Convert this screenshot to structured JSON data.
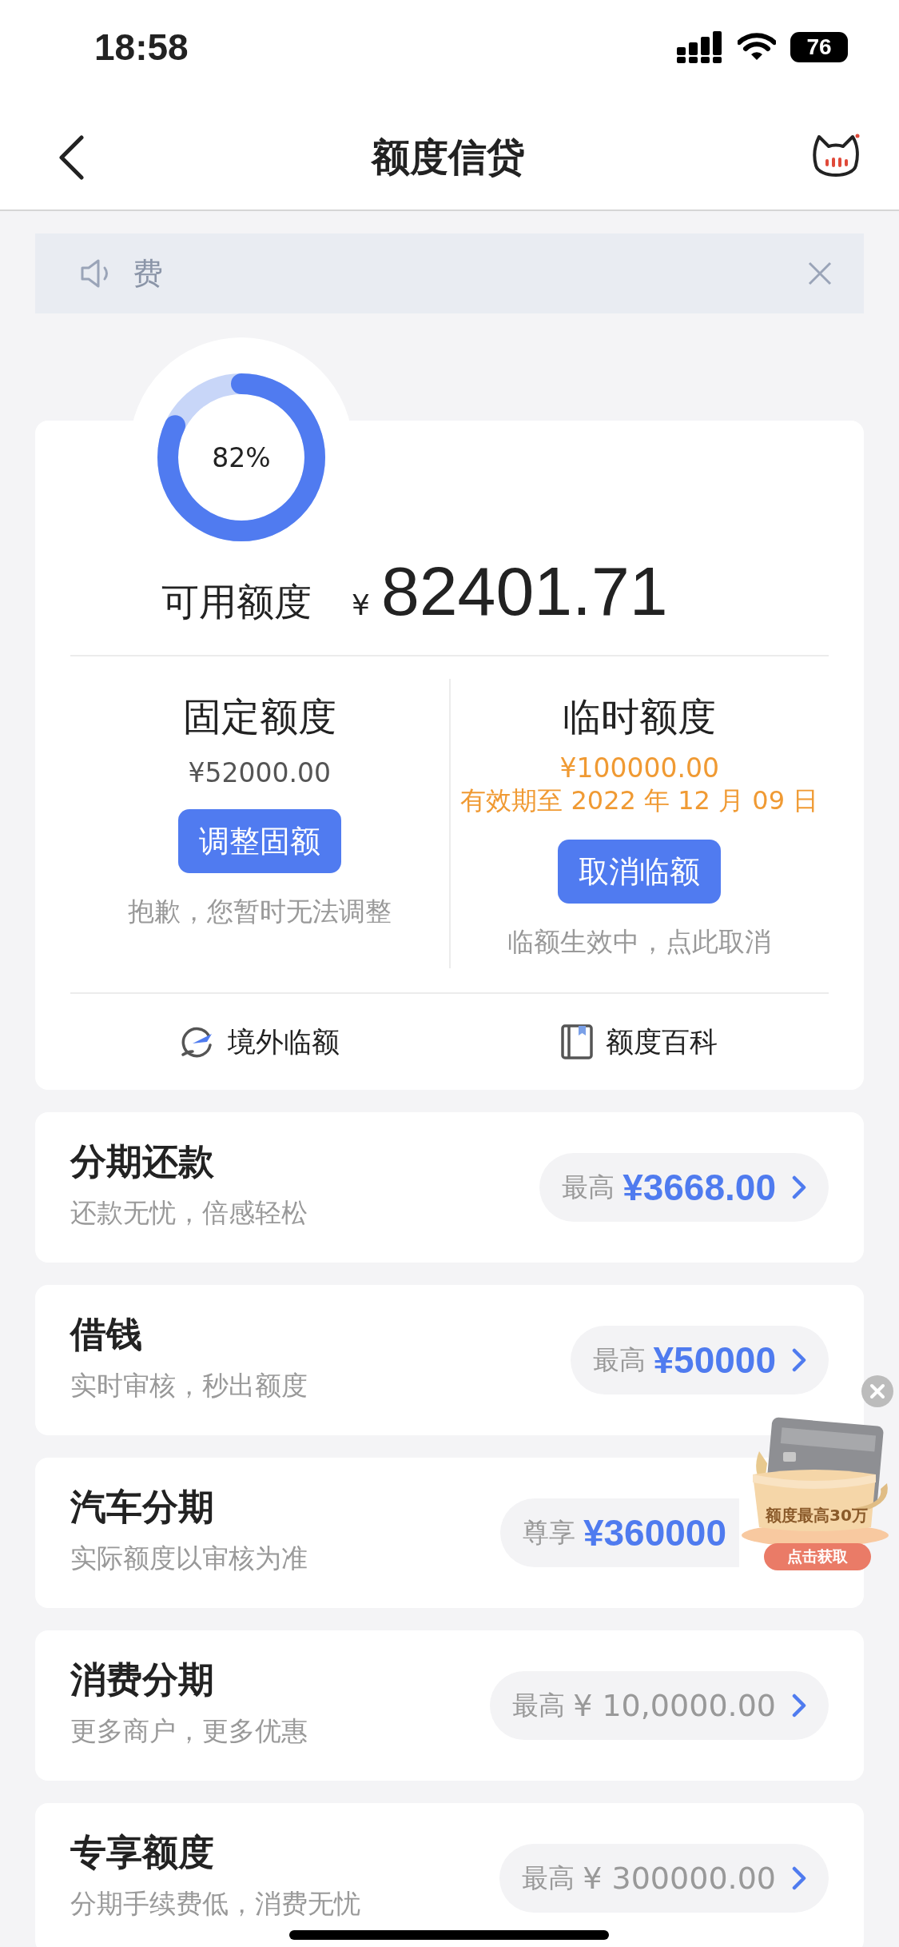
{
  "status_bar": {
    "time": "18:58",
    "battery": "76"
  },
  "nav": {
    "title": "额度信贷"
  },
  "notice": {
    "text": "费"
  },
  "summary": {
    "percent": "82%",
    "level": 0.82,
    "label": "可用额度",
    "currency": "¥",
    "amount": "82401.71"
  },
  "quotas": [
    {
      "title": "固定额度",
      "amount": "¥52000.00",
      "highlighted": false,
      "button": "调整固额",
      "note": "抱歉，您暂时无法调整"
    },
    {
      "title": "临时额度",
      "amount": "¥100000.00",
      "validity": "有效期至 2022 年 12 月 09 日",
      "highlighted": true,
      "button": "取消临额",
      "note": "临额生效中，点此取消"
    }
  ],
  "links": [
    {
      "kind": "travel",
      "label": "境外临额"
    },
    {
      "kind": "book",
      "label": "额度百科"
    }
  ],
  "products": [
    {
      "title": "分期还款",
      "subtitle": "还款无忧，倍感轻松",
      "prefix": "最高",
      "amount": "¥3668.00",
      "highlighted": true
    },
    {
      "title": "借钱",
      "subtitle": "实时审核，秒出额度",
      "prefix": "最高",
      "amount": "¥50000",
      "highlighted": true
    },
    {
      "title": "汽车分期",
      "subtitle": "实际额度以审核为准",
      "prefix": "尊享",
      "amount": "¥360000",
      "highlighted": true,
      "cut_off": true
    },
    {
      "title": "消费分期",
      "subtitle": "更多商户，更多优惠",
      "prefix": "最高",
      "amount": "¥ 10,0000.00",
      "highlighted": false
    },
    {
      "title": "专享额度",
      "subtitle": "分期手续费低，消费无忧",
      "prefix": "最高",
      "amount": "¥ 300000.00",
      "highlighted": false
    }
  ],
  "promo": {
    "headline": "额度最高30万",
    "button": "点击获取"
  }
}
